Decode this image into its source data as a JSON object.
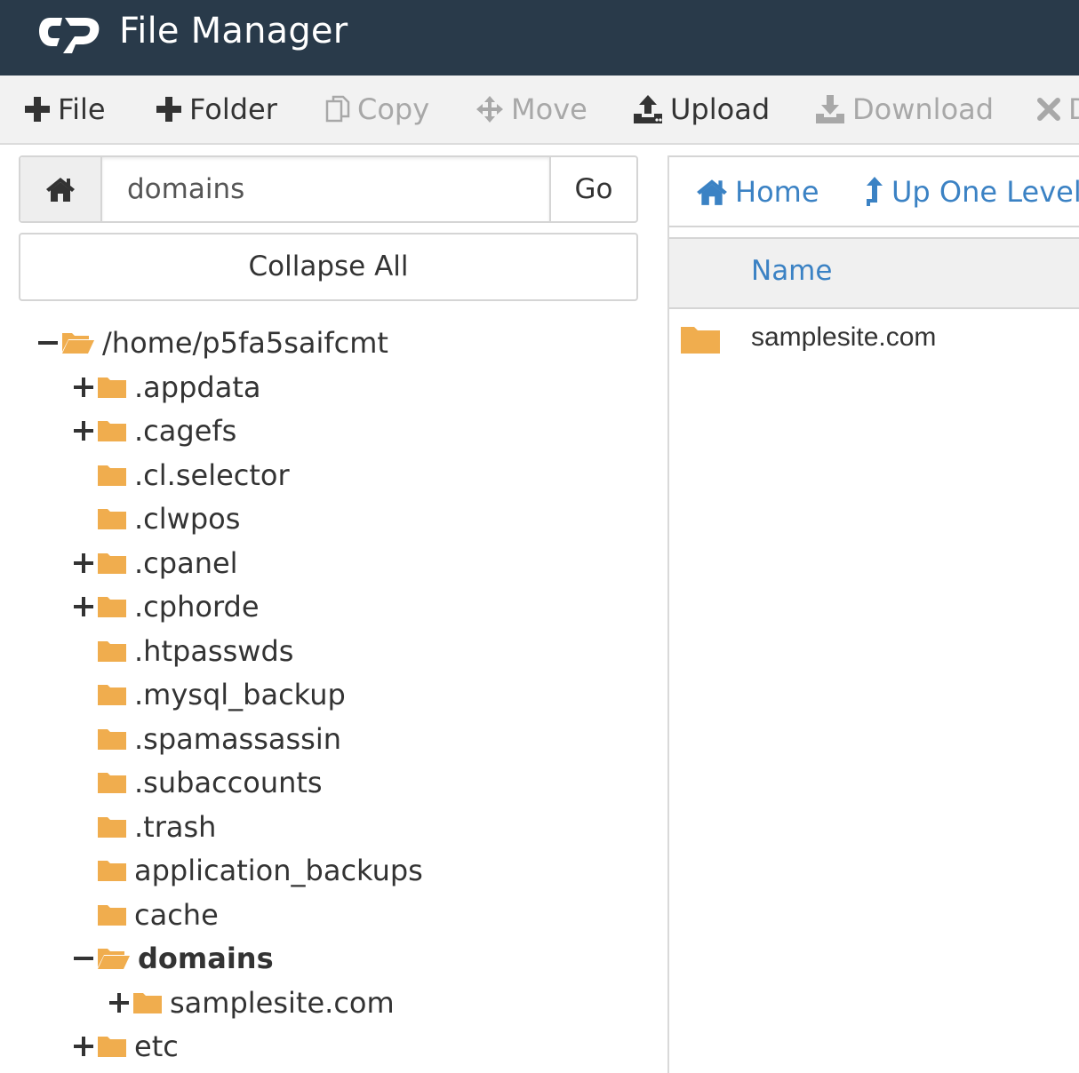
{
  "header": {
    "logo_alt": "cP",
    "title": "File Manager"
  },
  "toolbar": {
    "buttons": [
      {
        "label": "File",
        "icon": "plus-icon",
        "enabled": true
      },
      {
        "label": "Folder",
        "icon": "plus-icon",
        "enabled": true
      },
      {
        "label": "Copy",
        "icon": "copy-icon",
        "enabled": false
      },
      {
        "label": "Move",
        "icon": "move-arrows-icon",
        "enabled": false
      },
      {
        "label": "Upload",
        "icon": "upload-icon",
        "enabled": true
      },
      {
        "label": "Download",
        "icon": "download-icon",
        "enabled": false
      },
      {
        "label": "D",
        "icon": "close-icon",
        "enabled": false
      }
    ]
  },
  "path_bar": {
    "value": "domains",
    "go_label": "Go"
  },
  "collapse_all_label": "Collapse All",
  "tree": {
    "root": "/home/p5fa5saifcmt",
    "items": [
      {
        "label": ".appdata",
        "toggle": "plus"
      },
      {
        "label": ".cagefs",
        "toggle": "plus"
      },
      {
        "label": ".cl.selector",
        "toggle": "none"
      },
      {
        "label": ".clwpos",
        "toggle": "none"
      },
      {
        "label": ".cpanel",
        "toggle": "plus"
      },
      {
        "label": ".cphorde",
        "toggle": "plus"
      },
      {
        "label": ".htpasswds",
        "toggle": "none"
      },
      {
        "label": ".mysql_backup",
        "toggle": "none"
      },
      {
        "label": ".spamassassin",
        "toggle": "none"
      },
      {
        "label": ".subaccounts",
        "toggle": "none"
      },
      {
        "label": ".trash",
        "toggle": "none"
      },
      {
        "label": "application_backups",
        "toggle": "none"
      },
      {
        "label": "cache",
        "toggle": "none"
      },
      {
        "label": "domains",
        "toggle": "minus",
        "selected": true
      },
      {
        "label": "samplesite.com",
        "toggle": "plus",
        "child": true
      },
      {
        "label": "etc",
        "toggle": "plus"
      }
    ]
  },
  "right_nav": {
    "home_label": "Home",
    "up_label": "Up One Level"
  },
  "file_list": {
    "column_name": "Name",
    "rows": [
      {
        "name": "samplesite.com",
        "type": "folder"
      }
    ]
  },
  "colors": {
    "header_bg": "#293a4a",
    "folder": "#f0ad4e",
    "link": "#3b82c4",
    "disabled": "#a8a8a8"
  }
}
